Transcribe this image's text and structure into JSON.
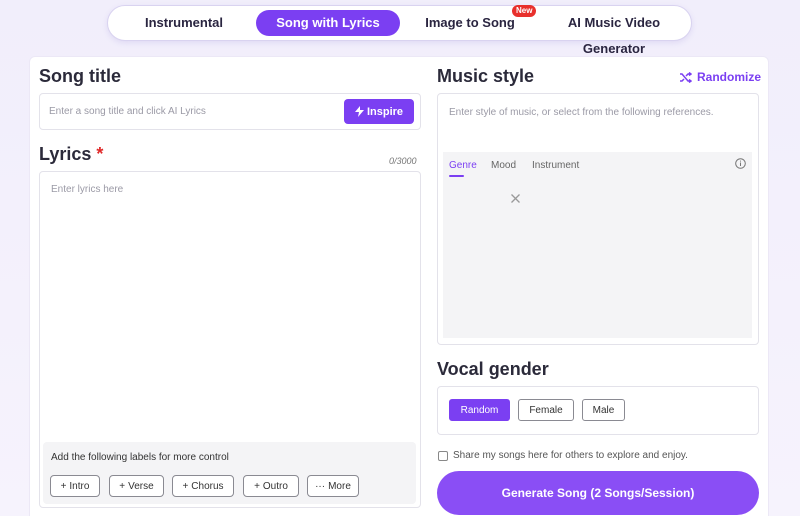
{
  "nav": {
    "tabs": [
      {
        "label": "Instrumental"
      },
      {
        "label": "Song with Lyrics"
      },
      {
        "label": "Image to Song"
      },
      {
        "label": "AI Music Video Generator"
      }
    ],
    "new_badge": "New"
  },
  "song_title": {
    "heading": "Song title",
    "placeholder": "Enter a song title and click AI Lyrics",
    "inspire_label": "Inspire"
  },
  "lyrics": {
    "heading": "Lyrics",
    "required_mark": "*",
    "counter": "0/3000",
    "placeholder": "Enter lyrics here",
    "labels_hint": "Add the following labels for more control",
    "chips": [
      {
        "prefix": "+",
        "label": "Intro"
      },
      {
        "prefix": "+",
        "label": "Verse"
      },
      {
        "prefix": "+",
        "label": "Chorus"
      },
      {
        "prefix": "+",
        "label": "Outro"
      },
      {
        "prefix": "···",
        "label": "More"
      }
    ]
  },
  "music_style": {
    "heading": "Music style",
    "randomize_label": "Randomize",
    "placeholder": "Enter style of music, or select from the following references.",
    "subtabs": [
      "Genre",
      "Mood",
      "Instrument"
    ]
  },
  "vocal_gender": {
    "heading": "Vocal gender",
    "options": [
      "Random",
      "Female",
      "Male"
    ],
    "selected": "Random"
  },
  "share_label": "Share my songs here for others to explore and enjoy.",
  "generate_label": "Generate Song (2 Songs/Session)",
  "colors": {
    "accent": "#7b3ff2",
    "required": "#e02828",
    "badge": "#e8302c"
  }
}
